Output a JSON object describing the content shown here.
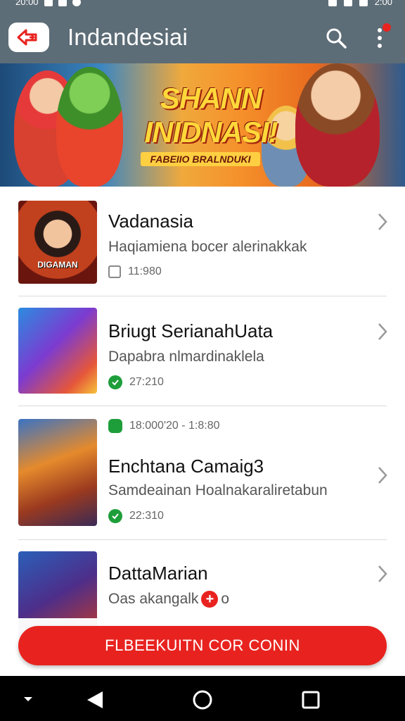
{
  "status_bar": {
    "left_text": "20:00",
    "right_text": "2:00"
  },
  "app_bar": {
    "title": "Indandesiai",
    "back_icon": "back-arrow-icon",
    "search_icon": "search-icon",
    "more_icon": "more-vertical-icon",
    "notification_color": "#e8231f"
  },
  "banner": {
    "title_line1": "SHANN",
    "title_line2": "INIDNASI!",
    "subtitle": "FABEIIO BRALNDUKI"
  },
  "items": [
    {
      "thumb_label": "DIGAMAN",
      "title": "Vadanasia",
      "description": "Haqiamiena bocer alerinakkak",
      "meta": "11:980",
      "meta_icon": "calendar-icon"
    },
    {
      "thumb_label": "",
      "title": "Briugt SerianahUata",
      "description": "Dapabra nlmardinaklela",
      "meta": "27:210",
      "meta_icon": "check-circle-icon"
    },
    {
      "thumb_label": "",
      "top_meta": "18:000'20 - 1:8:80",
      "title": "Enchtana Camaig3",
      "description": "Samdeainan Hoalnakaraliretabun",
      "meta": "22:310",
      "meta_icon": "check-circle-icon"
    },
    {
      "thumb_label": "",
      "title": "DattaMarian",
      "description": "Oas akangalk",
      "description_suffix": "o",
      "meta": "",
      "meta_icon": "plus-circle-icon"
    }
  ],
  "cta": {
    "label": "FLBEEKUITN COR CONIN"
  },
  "colors": {
    "app_bar": "#5d6d77",
    "accent": "#e8231f",
    "check": "#1e9e3a"
  }
}
